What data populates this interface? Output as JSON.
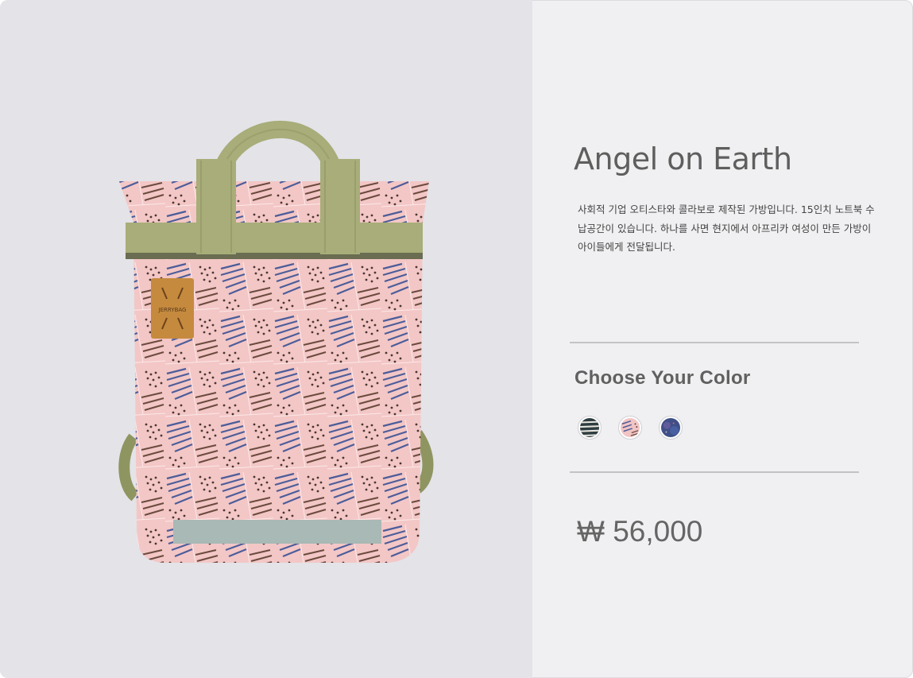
{
  "product": {
    "title": "Angel on Earth",
    "description": "사회적 기업 오티스타와 콜라보로 제작된 가방입니다. 15인치 노트북 수납공간이 있습니다. 하나를 사면 현지에서 아프리카 여성이 만든 가방이 아이들에게 전달됩니다.",
    "image_alt": "pink patterned backpack",
    "patch_label": "JERRYBAG"
  },
  "color_section": {
    "heading": "Choose Your Color",
    "swatches": [
      {
        "name": "dark stripe"
      },
      {
        "name": "pink pattern"
      },
      {
        "name": "navy galaxy"
      }
    ]
  },
  "price": "₩ 56,000",
  "colors": {
    "bag_pink": "#f2c4c4",
    "strap_olive": "#a8ad79",
    "pattern_blue": "#4c5d9a",
    "pattern_brown": "#6b4a3e",
    "panel_left": "#e4e3e8",
    "panel_right": "#f0f0f2"
  }
}
